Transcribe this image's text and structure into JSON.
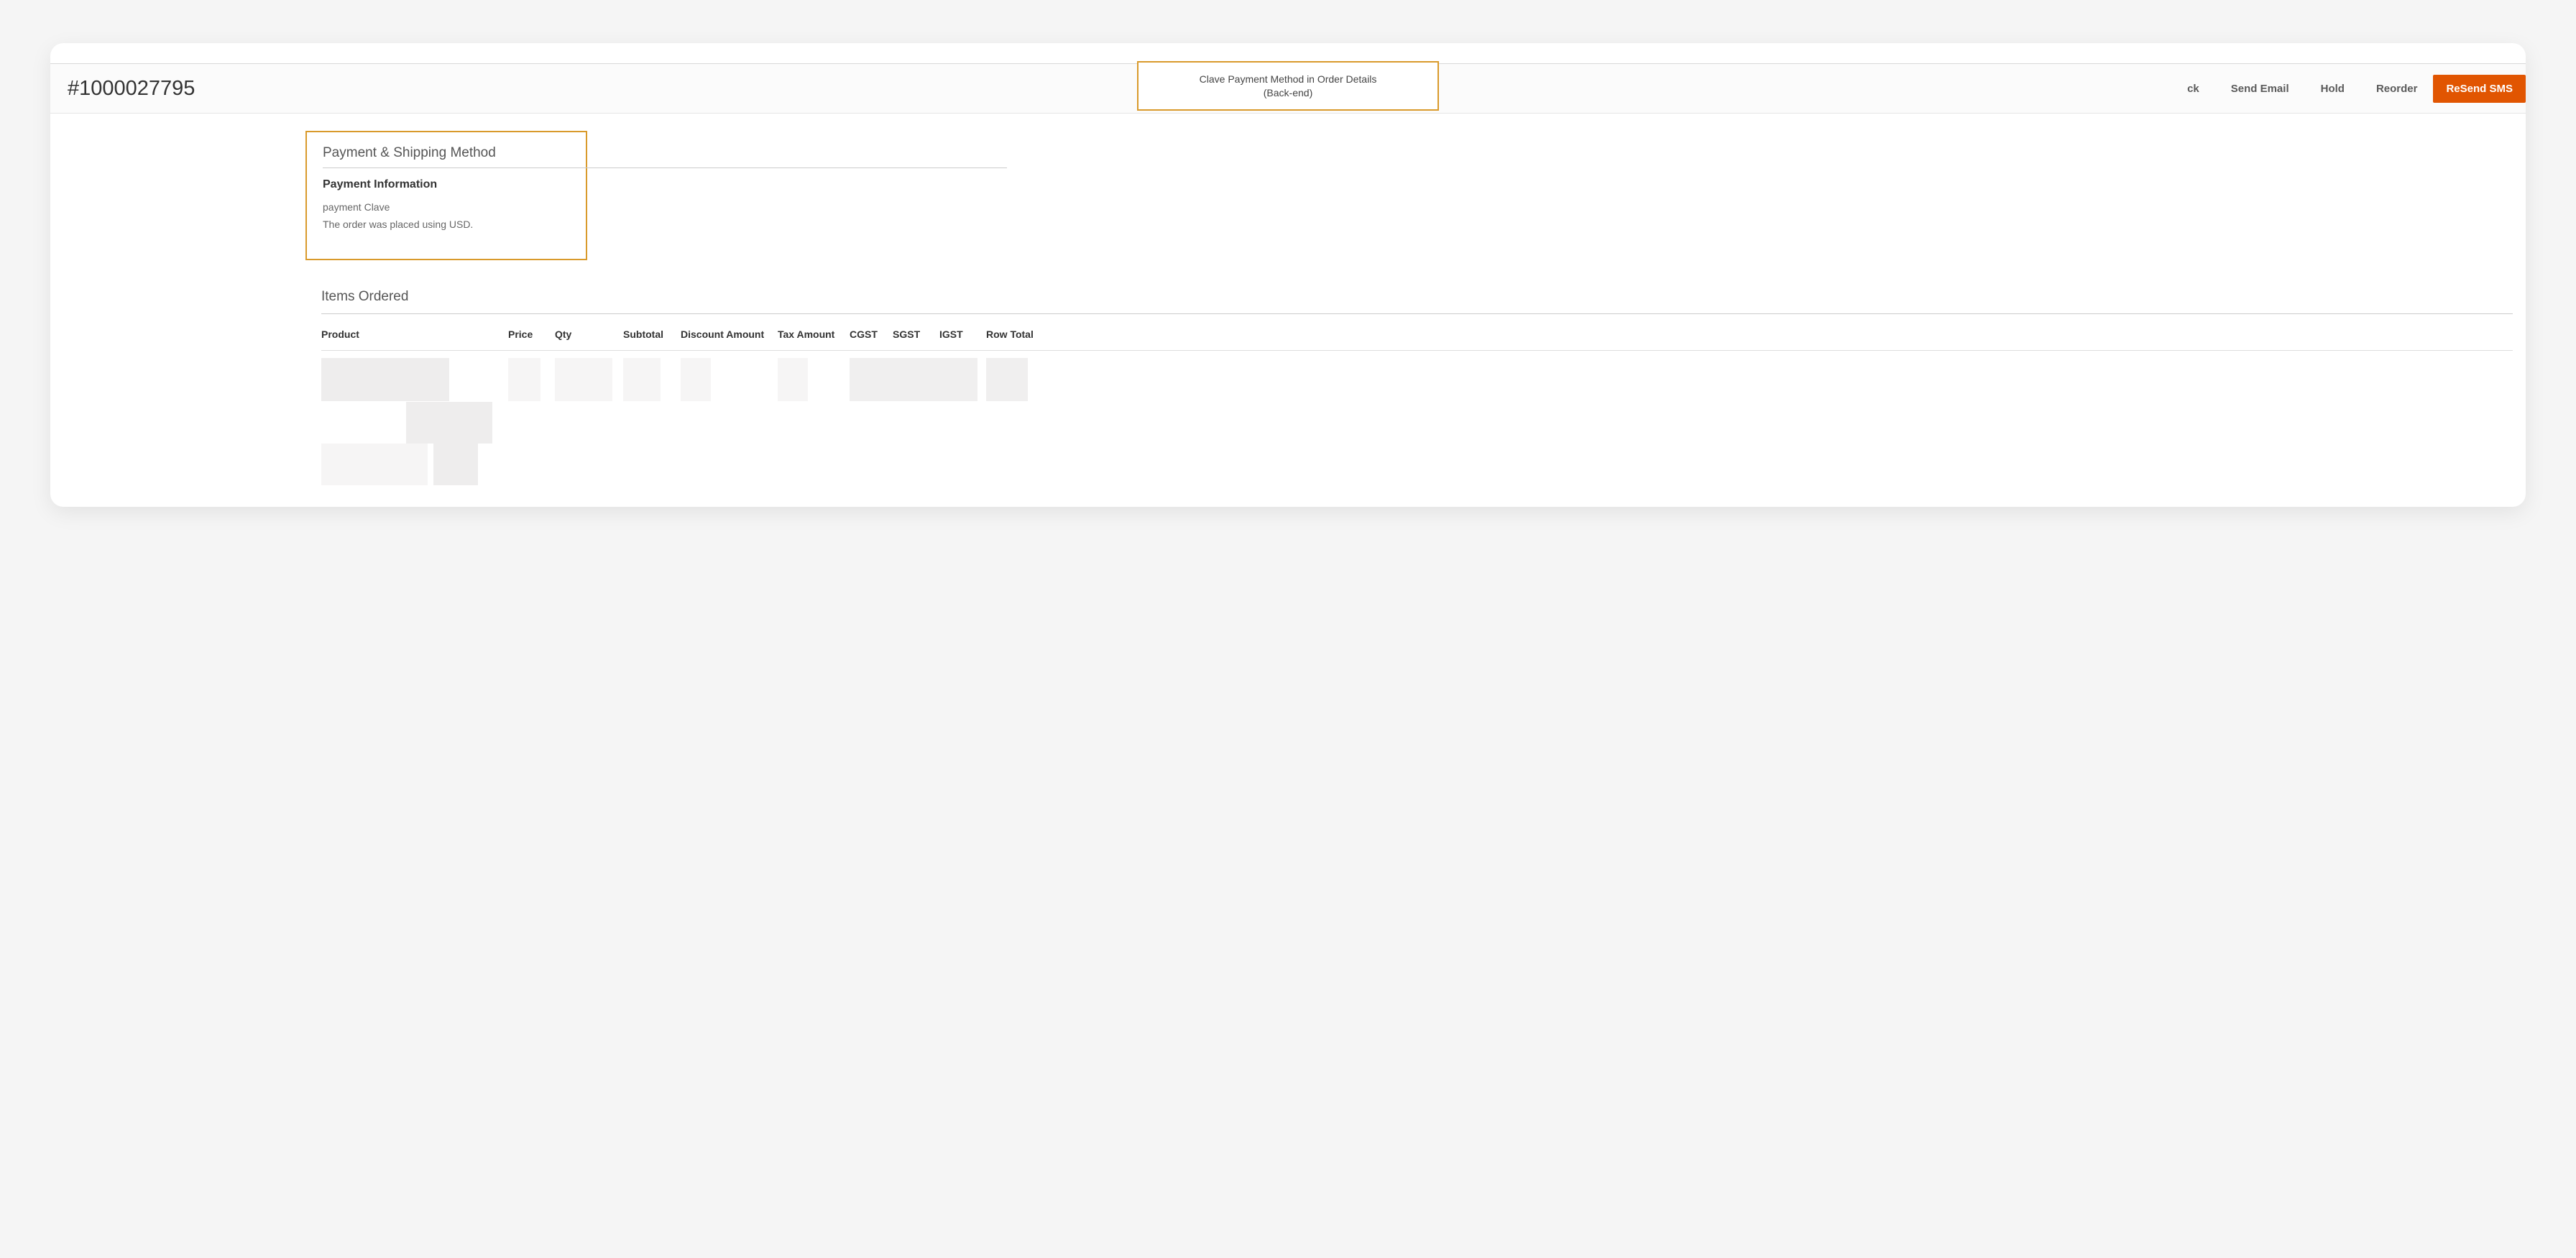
{
  "order": {
    "number": "#1000027795"
  },
  "callout": {
    "line1": "Clave Payment Method in Order Details",
    "line2": "(Back-end)"
  },
  "actions": {
    "back_partial": "ck",
    "send_email": "Send Email",
    "hold": "Hold",
    "reorder": "Reorder",
    "resend_sms": "ReSend SMS"
  },
  "payment": {
    "section_title": "Payment & Shipping Method",
    "info_title": "Payment Information",
    "method": "payment Clave",
    "currency_note": "The order was placed using USD."
  },
  "items": {
    "title": "Items Ordered",
    "columns": {
      "product": "Product",
      "price": "Price",
      "qty": "Qty",
      "subtotal": "Subtotal",
      "discount": "Discount Amount",
      "tax": "Tax Amount",
      "cgst": "CGST",
      "sgst": "SGST",
      "igst": "IGST",
      "row_total": "Row Total"
    }
  }
}
